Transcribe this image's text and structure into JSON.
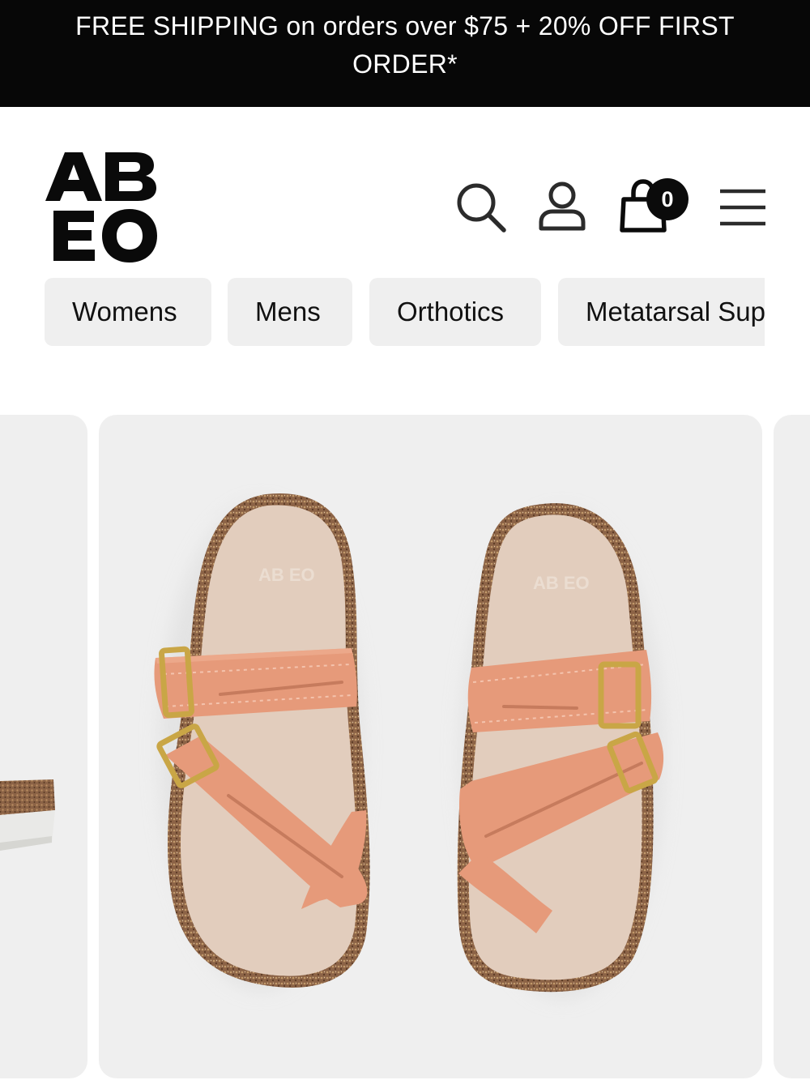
{
  "promo": {
    "text": "FREE SHIPPING on orders over $75 + 20% OFF FIRST ORDER*"
  },
  "header": {
    "logo_text": "AB EO",
    "cart_count": "0",
    "icons": [
      "search-icon",
      "account-icon",
      "bag-icon",
      "menu-icon"
    ]
  },
  "nav": {
    "pills": [
      {
        "label": "Womens"
      },
      {
        "label": "Mens"
      },
      {
        "label": "Orthotics"
      },
      {
        "label": "Metatarsal Support"
      }
    ]
  },
  "carousel": {
    "logo_on_footbed": "AB EO"
  },
  "colors": {
    "promo_background": "#070707",
    "pill_background": "#efefef",
    "card_background": "#efefef",
    "strap": "#e69a7a",
    "footbed": "#e2cdbd",
    "cork": "#8c6346",
    "buckle": "#c9a646"
  }
}
